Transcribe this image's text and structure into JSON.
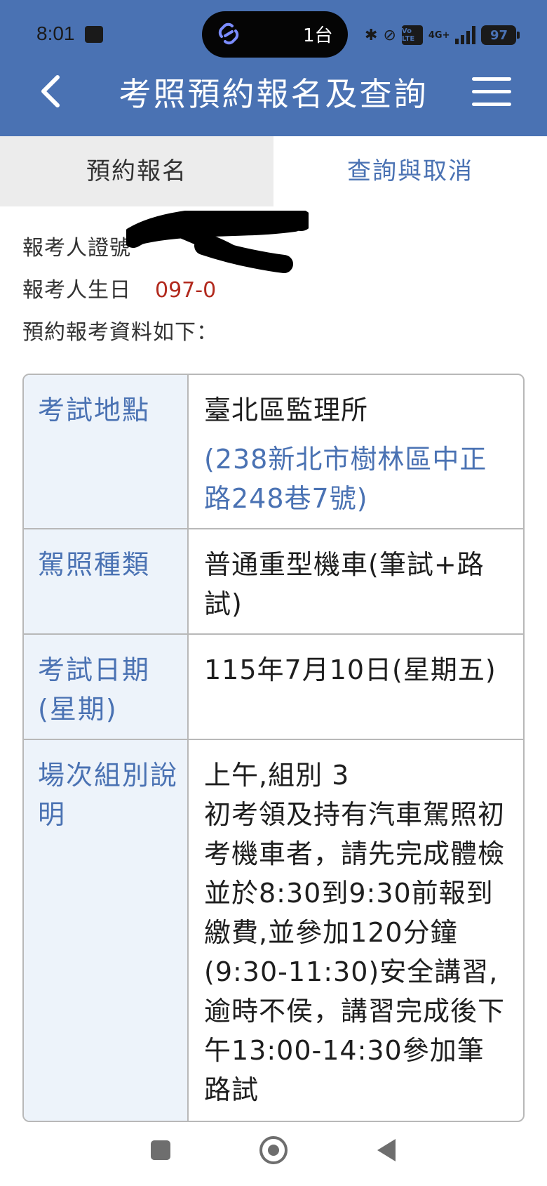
{
  "status_bar": {
    "time": "8:01",
    "pill_text": "1台",
    "network": "4G+",
    "volte": "Vo LTE",
    "battery": "97"
  },
  "header": {
    "title": "考照預約報名及查詢"
  },
  "tabs": [
    {
      "label": "預約報名",
      "active": true
    },
    {
      "label": "查詢與取消",
      "active": false
    }
  ],
  "applicant": {
    "id_label": "報考人證號",
    "birthday_label": "報考人生日",
    "birthday_value": "097-0",
    "intro": "預約報考資料如下："
  },
  "table": {
    "rows": [
      {
        "label": "考試地點",
        "value": "臺北區監理所",
        "sub_value": "(238新北市樹林區中正路248巷7號)"
      },
      {
        "label": "駕照種類",
        "value": "普通重型機車(筆試+路試)"
      },
      {
        "label": "考試日期(星期)",
        "value": "115年7月10日(星期五)"
      },
      {
        "label": "場次組別說明",
        "value_lines": [
          "上午,組別 3",
          "初考領及持有汽車駕照初考機車者，請先完成體檢並於8:30到9:30前報到繳費,並參加120分鐘(9:30-11:30)安全講習,逾時不侯，講習完成後下午13:00-14:30參加筆路試"
        ]
      }
    ]
  },
  "colors": {
    "header_bg": "#4a72b3",
    "label_text": "#4a72b3",
    "label_bg": "#edf3fa",
    "birthday_text": "#b22a1e"
  }
}
